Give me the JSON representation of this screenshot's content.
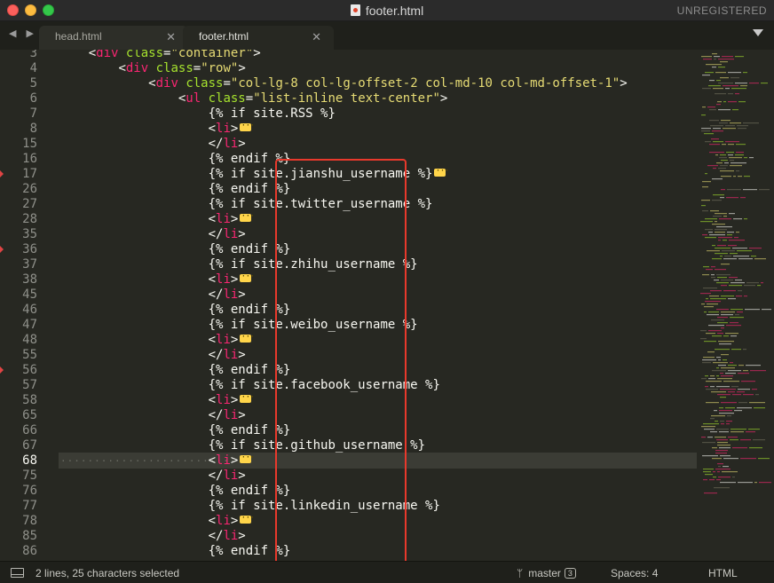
{
  "window": {
    "title": "footer.html",
    "license_status": "UNREGISTERED"
  },
  "tabs": [
    {
      "label": "head.html",
      "active": false,
      "close_glyph": "✕"
    },
    {
      "label": "footer.html",
      "active": true,
      "close_glyph": "✕"
    }
  ],
  "nav_arrows": "◀ ▶",
  "icons": {
    "file": "file-icon",
    "fold_marker": "ellipsis-fold-icon",
    "branch": "git-branch-icon",
    "panel": "panel-toggle-icon"
  },
  "colors": {
    "background": "#272822",
    "tag": "#f92672",
    "attribute": "#a6e22e",
    "string": "#e6db74",
    "plain": "#f8f8f2",
    "highlight_box": "#e8392c"
  },
  "editor": {
    "current_line": "68",
    "lines": [
      {
        "num": "3",
        "indent": "    ",
        "tokens": [
          {
            "t": "<",
            "c": "pl"
          },
          {
            "t": "div",
            "c": "tag"
          },
          {
            "t": " ",
            "c": "pl"
          },
          {
            "t": "class",
            "c": "attr"
          },
          {
            "t": "=",
            "c": "pl"
          },
          {
            "t": "\"container\"",
            "c": "str"
          },
          {
            "t": ">",
            "c": "pl"
          }
        ],
        "fold": false,
        "mark": false
      },
      {
        "num": "4",
        "indent": "        ",
        "tokens": [
          {
            "t": "<",
            "c": "pl"
          },
          {
            "t": "div",
            "c": "tag"
          },
          {
            "t": " ",
            "c": "pl"
          },
          {
            "t": "class",
            "c": "attr"
          },
          {
            "t": "=",
            "c": "pl"
          },
          {
            "t": "\"row\"",
            "c": "str"
          },
          {
            "t": ">",
            "c": "pl"
          }
        ],
        "fold": false,
        "mark": false
      },
      {
        "num": "5",
        "indent": "            ",
        "tokens": [
          {
            "t": "<",
            "c": "pl"
          },
          {
            "t": "div",
            "c": "tag"
          },
          {
            "t": " ",
            "c": "pl"
          },
          {
            "t": "class",
            "c": "attr"
          },
          {
            "t": "=",
            "c": "pl"
          },
          {
            "t": "\"col-lg-8 col-lg-offset-2 col-md-10 col-md-offset-1\"",
            "c": "str"
          },
          {
            "t": ">",
            "c": "pl"
          }
        ],
        "fold": false,
        "mark": false
      },
      {
        "num": "6",
        "indent": "                ",
        "tokens": [
          {
            "t": "<",
            "c": "pl"
          },
          {
            "t": "ul",
            "c": "tag"
          },
          {
            "t": " ",
            "c": "pl"
          },
          {
            "t": "class",
            "c": "attr"
          },
          {
            "t": "=",
            "c": "pl"
          },
          {
            "t": "\"list-inline text-center\"",
            "c": "str"
          },
          {
            "t": ">",
            "c": "pl"
          }
        ],
        "fold": false,
        "mark": false
      },
      {
        "num": "7",
        "indent": "                    ",
        "tokens": [
          {
            "t": "{% if site.RSS %}",
            "c": "pl"
          }
        ],
        "fold": false,
        "mark": false
      },
      {
        "num": "8",
        "indent": "                    ",
        "tokens": [
          {
            "t": "<",
            "c": "pl"
          },
          {
            "t": "li",
            "c": "tag"
          },
          {
            "t": ">",
            "c": "pl"
          }
        ],
        "fold": true,
        "mark": false
      },
      {
        "num": "15",
        "indent": "                    ",
        "tokens": [
          {
            "t": "</",
            "c": "pl"
          },
          {
            "t": "li",
            "c": "tag"
          },
          {
            "t": ">",
            "c": "pl"
          }
        ],
        "fold": false,
        "mark": false
      },
      {
        "num": "16",
        "indent": "                    ",
        "tokens": [
          {
            "t": "{% endif %}",
            "c": "pl"
          }
        ],
        "fold": false,
        "mark": false
      },
      {
        "num": "17",
        "indent": "                    ",
        "tokens": [
          {
            "t": "{% if site.jianshu_username %}",
            "c": "pl"
          }
        ],
        "fold": true,
        "mark": true
      },
      {
        "num": "26",
        "indent": "                    ",
        "tokens": [
          {
            "t": "{% endif %}",
            "c": "pl"
          }
        ],
        "fold": false,
        "mark": false
      },
      {
        "num": "27",
        "indent": "                    ",
        "tokens": [
          {
            "t": "{% if site.twitter_username %}",
            "c": "pl"
          }
        ],
        "fold": false,
        "mark": false
      },
      {
        "num": "28",
        "indent": "                    ",
        "tokens": [
          {
            "t": "<",
            "c": "pl"
          },
          {
            "t": "li",
            "c": "tag"
          },
          {
            "t": ">",
            "c": "pl"
          }
        ],
        "fold": true,
        "mark": false
      },
      {
        "num": "35",
        "indent": "                    ",
        "tokens": [
          {
            "t": "</",
            "c": "pl"
          },
          {
            "t": "li",
            "c": "tag"
          },
          {
            "t": ">",
            "c": "pl"
          }
        ],
        "fold": false,
        "mark": false
      },
      {
        "num": "36",
        "indent": "                    ",
        "tokens": [
          {
            "t": "{% endif %}",
            "c": "pl"
          }
        ],
        "fold": false,
        "mark": true
      },
      {
        "num": "37",
        "indent": "                    ",
        "tokens": [
          {
            "t": "{% if site.zhihu_username %}",
            "c": "pl"
          }
        ],
        "fold": false,
        "mark": false
      },
      {
        "num": "38",
        "indent": "                    ",
        "tokens": [
          {
            "t": "<",
            "c": "pl"
          },
          {
            "t": "li",
            "c": "tag"
          },
          {
            "t": ">",
            "c": "pl"
          }
        ],
        "fold": true,
        "mark": false
      },
      {
        "num": "45",
        "indent": "                    ",
        "tokens": [
          {
            "t": "</",
            "c": "pl"
          },
          {
            "t": "li",
            "c": "tag"
          },
          {
            "t": ">",
            "c": "pl"
          }
        ],
        "fold": false,
        "mark": false
      },
      {
        "num": "46",
        "indent": "                    ",
        "tokens": [
          {
            "t": "{% endif %}",
            "c": "pl"
          }
        ],
        "fold": false,
        "mark": false
      },
      {
        "num": "47",
        "indent": "                    ",
        "tokens": [
          {
            "t": "{% if site.weibo_username %}",
            "c": "pl"
          }
        ],
        "fold": false,
        "mark": false
      },
      {
        "num": "48",
        "indent": "                    ",
        "tokens": [
          {
            "t": "<",
            "c": "pl"
          },
          {
            "t": "li",
            "c": "tag"
          },
          {
            "t": ">",
            "c": "pl"
          }
        ],
        "fold": true,
        "mark": false
      },
      {
        "num": "55",
        "indent": "                    ",
        "tokens": [
          {
            "t": "</",
            "c": "pl"
          },
          {
            "t": "li",
            "c": "tag"
          },
          {
            "t": ">",
            "c": "pl"
          }
        ],
        "fold": false,
        "mark": false
      },
      {
        "num": "56",
        "indent": "                    ",
        "tokens": [
          {
            "t": "{% endif %}",
            "c": "pl"
          }
        ],
        "fold": false,
        "mark": true
      },
      {
        "num": "57",
        "indent": "                    ",
        "tokens": [
          {
            "t": "{% if site.facebook_username %}",
            "c": "pl"
          }
        ],
        "fold": false,
        "mark": false
      },
      {
        "num": "58",
        "indent": "                    ",
        "tokens": [
          {
            "t": "<",
            "c": "pl"
          },
          {
            "t": "li",
            "c": "tag"
          },
          {
            "t": ">",
            "c": "pl"
          }
        ],
        "fold": true,
        "mark": false
      },
      {
        "num": "65",
        "indent": "                    ",
        "tokens": [
          {
            "t": "</",
            "c": "pl"
          },
          {
            "t": "li",
            "c": "tag"
          },
          {
            "t": ">",
            "c": "pl"
          }
        ],
        "fold": false,
        "mark": false
      },
      {
        "num": "66",
        "indent": "                    ",
        "tokens": [
          {
            "t": "{% endif %}",
            "c": "pl"
          }
        ],
        "fold": false,
        "mark": false
      },
      {
        "num": "67",
        "indent": "                    ",
        "tokens": [
          {
            "t": "{% if site.github_username %}",
            "c": "pl"
          }
        ],
        "fold": false,
        "mark": false
      },
      {
        "num": "68",
        "indent": "                    ",
        "tokens": [
          {
            "t": "<",
            "c": "pl"
          },
          {
            "t": "li",
            "c": "tag"
          },
          {
            "t": ">",
            "c": "pl"
          }
        ],
        "fold": true,
        "mark": false
      },
      {
        "num": "75",
        "indent": "                    ",
        "tokens": [
          {
            "t": "</",
            "c": "pl"
          },
          {
            "t": "li",
            "c": "tag"
          },
          {
            "t": ">",
            "c": "pl"
          }
        ],
        "fold": false,
        "mark": false
      },
      {
        "num": "76",
        "indent": "                    ",
        "tokens": [
          {
            "t": "{% endif %}",
            "c": "pl"
          }
        ],
        "fold": false,
        "mark": false
      },
      {
        "num": "77",
        "indent": "                    ",
        "tokens": [
          {
            "t": "{% if site.linkedin_username %}",
            "c": "pl"
          }
        ],
        "fold": false,
        "mark": false
      },
      {
        "num": "78",
        "indent": "                    ",
        "tokens": [
          {
            "t": "<",
            "c": "pl"
          },
          {
            "t": "li",
            "c": "tag"
          },
          {
            "t": ">",
            "c": "pl"
          }
        ],
        "fold": true,
        "mark": false
      },
      {
        "num": "85",
        "indent": "                    ",
        "tokens": [
          {
            "t": "</",
            "c": "pl"
          },
          {
            "t": "li",
            "c": "tag"
          },
          {
            "t": ">",
            "c": "pl"
          }
        ],
        "fold": false,
        "mark": false
      },
      {
        "num": "86",
        "indent": "                    ",
        "tokens": [
          {
            "t": "{% endif %}",
            "c": "pl"
          }
        ],
        "fold": false,
        "mark": false
      }
    ]
  },
  "status": {
    "selection": "2 lines, 25 characters selected",
    "branch": "master",
    "branch_changes": "3",
    "indentation": "Spaces: 4",
    "syntax": "HTML"
  }
}
